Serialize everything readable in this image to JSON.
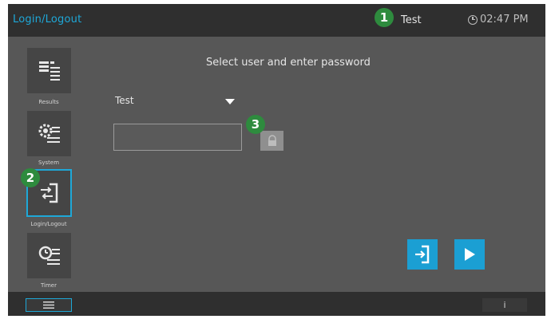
{
  "header": {
    "title": "Login/Logout",
    "user": "Test",
    "time": "02:47 PM",
    "clock_icon": "clock-icon"
  },
  "nav": {
    "items": [
      {
        "label": "Results",
        "icon": "results-icon",
        "active": false
      },
      {
        "label": "System",
        "icon": "system-icon",
        "active": false
      },
      {
        "label": "Login/Logout",
        "icon": "login-logout-icon",
        "active": true
      },
      {
        "label": "Timer",
        "icon": "timer-icon",
        "active": false
      }
    ]
  },
  "main": {
    "prompt": "Select user and enter password",
    "user_select": {
      "value": "Test"
    },
    "password": {
      "value": "",
      "placeholder": ""
    },
    "keyboard_icon": "keyboard-icon"
  },
  "actions": {
    "logout_icon": "logout-icon",
    "continue_icon": "play-icon"
  },
  "footer": {
    "menu_icon": "menu-icon",
    "info_label": "i"
  },
  "callouts": [
    "1",
    "2",
    "3"
  ],
  "colors": {
    "accent": "#1ea8d8",
    "background": "#575757",
    "bar": "#2f2f2f",
    "callout": "#2e8b3e"
  }
}
